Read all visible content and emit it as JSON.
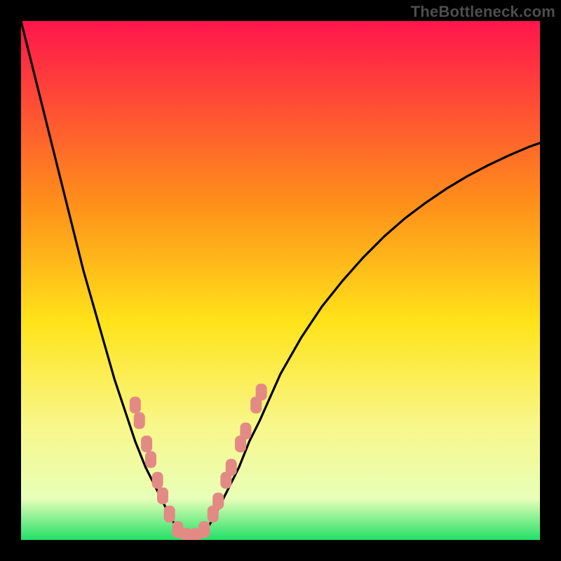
{
  "watermark": "TheBottleneck.com",
  "colors": {
    "background": "#000000",
    "curve": "#000000",
    "marker_fill": "#e38a84",
    "grad_top": "#ff154c",
    "grad_mid_upper": "#ff8f1a",
    "grad_mid": "#ffe31a",
    "grad_mid_lower": "#f8f78a",
    "grad_low": "#e8ffb8",
    "grad_bottom": "#22e067",
    "watermark": "#4d4d4d"
  },
  "chart_data": {
    "type": "line",
    "title": "",
    "xlabel": "",
    "ylabel": "",
    "xlim": [
      0,
      100
    ],
    "ylim": [
      0,
      100
    ],
    "legend": false,
    "grid": false,
    "curve_comment": "x is horizontal % across inner plot, y is vertical % from top (0) to bottom (100); values eyeballed from pixel positions",
    "x": [
      0,
      2,
      4,
      6,
      8,
      10,
      12,
      14,
      16,
      18,
      20,
      22,
      24,
      26,
      27,
      28,
      29,
      30,
      31,
      32,
      33,
      34,
      35,
      36,
      37,
      38,
      40,
      42,
      44,
      46,
      48,
      50,
      54,
      58,
      62,
      66,
      70,
      74,
      78,
      82,
      86,
      90,
      94,
      98,
      100
    ],
    "y": [
      0,
      8,
      16,
      24,
      32,
      40,
      48,
      55,
      62,
      69,
      75,
      81,
      86,
      90,
      92,
      94,
      96,
      97.5,
      98.6,
      99.2,
      99.5,
      99.2,
      98.6,
      97.5,
      96,
      94,
      90,
      86,
      81,
      77,
      72.5,
      68,
      61,
      55,
      50,
      45.5,
      41.5,
      38,
      35,
      32.3,
      29.9,
      27.8,
      25.9,
      24.2,
      23.5
    ],
    "markers_comment": "rounded-rectangle salmon markers placed along both flanks of the valley; approximate centres in same % coordinate system",
    "markers": [
      {
        "x": 22.0,
        "y": 74.0
      },
      {
        "x": 22.8,
        "y": 77.0
      },
      {
        "x": 24.2,
        "y": 81.5
      },
      {
        "x": 25.0,
        "y": 84.5
      },
      {
        "x": 26.3,
        "y": 88.5
      },
      {
        "x": 27.3,
        "y": 91.5
      },
      {
        "x": 28.6,
        "y": 95.0
      },
      {
        "x": 30.2,
        "y": 98.0
      },
      {
        "x": 31.9,
        "y": 99.3
      },
      {
        "x": 33.6,
        "y": 99.3
      },
      {
        "x": 35.3,
        "y": 98.0
      },
      {
        "x": 37.0,
        "y": 95.0
      },
      {
        "x": 38.0,
        "y": 92.5
      },
      {
        "x": 39.5,
        "y": 88.5
      },
      {
        "x": 40.5,
        "y": 86.0
      },
      {
        "x": 42.3,
        "y": 81.5
      },
      {
        "x": 43.3,
        "y": 79.0
      },
      {
        "x": 45.3,
        "y": 74.0
      },
      {
        "x": 46.3,
        "y": 71.5
      }
    ]
  }
}
